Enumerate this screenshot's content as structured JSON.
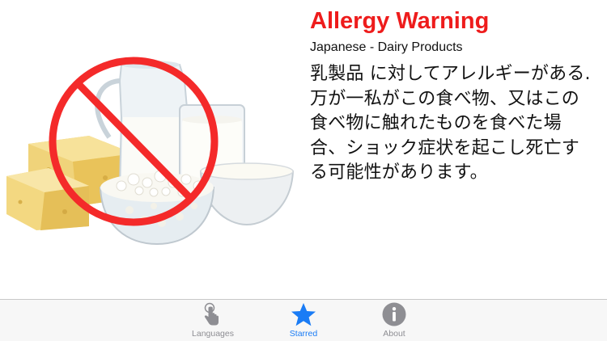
{
  "main": {
    "title": "Allergy Warning",
    "subtitle": "Japanese - Dairy Products",
    "warning_text": "乳製品 に対してアレルギーがある. 万が一私がこの食べ物、又はこの食べ物に触れたものを食べた場合、ショック症状を起こし死亡する可能性があります。",
    "image_icon": "no-dairy-products-image"
  },
  "tabbar": {
    "tabs": [
      {
        "label": "Languages",
        "icon": "pointing-hand-icon",
        "active": false
      },
      {
        "label": "Starred",
        "icon": "star-icon",
        "active": true
      },
      {
        "label": "About",
        "icon": "info-icon",
        "active": false
      }
    ]
  },
  "colors": {
    "title": "#ee1c1c",
    "prohibition": "#f42a2a",
    "active_tab": "#1a7cf5",
    "inactive_tab": "#8e8e93",
    "tabbar_bg": "#f7f7f7"
  }
}
